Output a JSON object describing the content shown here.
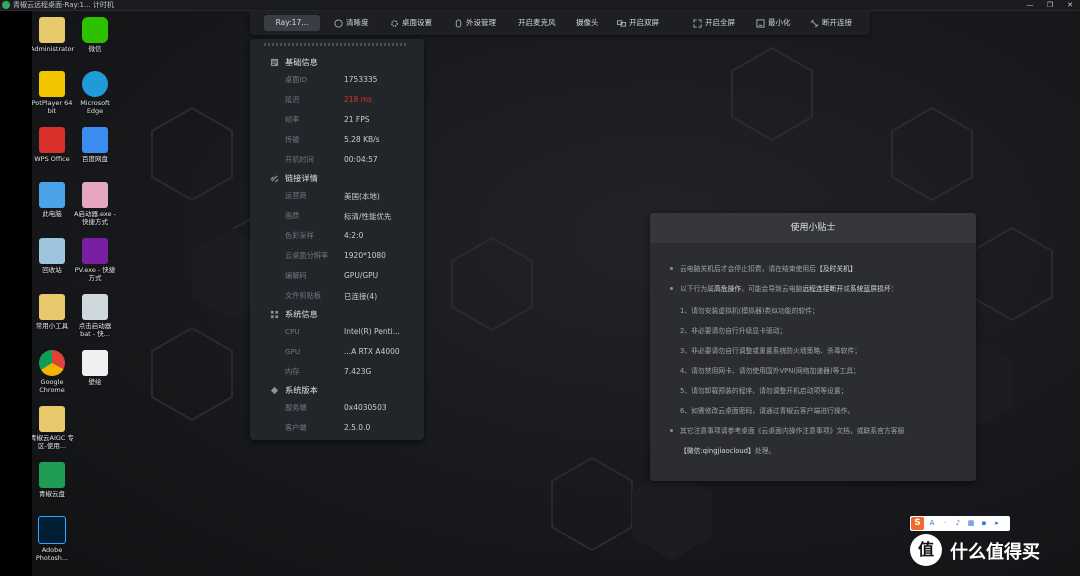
{
  "window": {
    "title": "青椒云远程桌面-Ray:1... 计时机",
    "minimize_glyph": "—",
    "restore_glyph": "❐",
    "close_glyph": "✕"
  },
  "desktop_icons": [
    {
      "name": "administrator-icon",
      "label": "Administrator",
      "icon": "folder-user-icon",
      "color": "#e7c86a"
    },
    {
      "name": "wechat-icon",
      "label": "微信",
      "icon": "wechat-icon",
      "color": "#2dc100"
    },
    {
      "name": "potplayer-icon",
      "label": "PotPlayer 64 bit",
      "icon": "potplayer-icon",
      "color": "#f2c400"
    },
    {
      "name": "edge-icon",
      "label": "Microsoft Edge",
      "icon": "edge-icon",
      "color": "#1f9cd8"
    },
    {
      "name": "wps-icon",
      "label": "WPS Office",
      "icon": "wps-icon",
      "color": "#d9302b"
    },
    {
      "name": "baidu-netdisk-icon",
      "label": "百度网盘",
      "icon": "baidu-netdisk-icon",
      "color": "#3b8df0"
    },
    {
      "name": "this-pc-icon",
      "label": "此电脑",
      "icon": "computer-icon",
      "color": "#4aa3e8"
    },
    {
      "name": "a-launcher-icon",
      "label": "A启动器.exe - 快捷方式",
      "icon": "anime-avatar-icon",
      "color": "#e7a6c0"
    },
    {
      "name": "recycle-bin-icon",
      "label": "回收站",
      "icon": "recycle-bin-icon",
      "color": "#9ec4de"
    },
    {
      "name": "pv-shortcut-icon",
      "label": "PV.exe - 快捷方式",
      "icon": "pv-icon",
      "color": "#7b1fa2"
    },
    {
      "name": "tools-icon",
      "label": "常用小工具",
      "icon": "folder-tools-icon",
      "color": "#e7c86a"
    },
    {
      "name": "launcher-bat-icon",
      "label": "点击启动器 bat - 快...",
      "icon": "bat-file-icon",
      "color": "#cfd8dc"
    },
    {
      "name": "chrome-icon",
      "label": "Google Chrome",
      "icon": "chrome-icon",
      "color": "#db4437"
    },
    {
      "name": "sketch-icon",
      "label": "壁绘",
      "icon": "sketch-icon",
      "color": "#f0f0f0"
    },
    {
      "name": "aigc-icon",
      "label": "青椒云AIGC 专区-使用...",
      "icon": "doc-icon",
      "color": "#e7c86a"
    },
    {
      "name": "qingjiao-disk-icon",
      "label": "青椒云盘",
      "icon": "qingjiao-icon",
      "color": "#1f9d55"
    },
    {
      "name": "photoshop-icon",
      "label": "Adobe Photosh...",
      "icon": "photoshop-icon",
      "color": "#31a8ff"
    }
  ],
  "toolbar": {
    "user_label": "Ray:17...",
    "items": [
      {
        "name": "clarity-button",
        "label": "清晰度",
        "icon": "clarity-icon"
      },
      {
        "name": "desktop-settings-button",
        "label": "桌面设置",
        "icon": "gear-icon"
      },
      {
        "name": "peripheral-button",
        "label": "外设管理",
        "icon": "mouse-icon"
      },
      {
        "name": "mic-button",
        "label": "开启麦克风",
        "icon": ""
      },
      {
        "name": "camera-button",
        "label": "摄像头",
        "icon": ""
      },
      {
        "name": "dual-screen-button",
        "label": "开启双屏",
        "icon": "dual-screen-icon"
      },
      {
        "name": "fullscreen-button",
        "label": "开启全屏",
        "icon": "fullscreen-icon"
      },
      {
        "name": "minimize-button",
        "label": "最小化",
        "icon": "minimize-icon"
      },
      {
        "name": "disconnect-button",
        "label": "断开连接",
        "icon": "disconnect-icon"
      }
    ]
  },
  "info_panel": {
    "sections": [
      {
        "name": "basic-info",
        "title": "基础信息",
        "icon": "list-icon",
        "rows": [
          {
            "label": "桌面ID",
            "value": "1753335",
            "status": ""
          },
          {
            "label": "延迟",
            "value": "218 ms",
            "status": "bad"
          },
          {
            "label": "帧率",
            "value": "21 FPS",
            "status": ""
          },
          {
            "label": "传输",
            "value": "5.28 KB/s",
            "status": ""
          },
          {
            "label": "开机时间",
            "value": "00:04:57",
            "status": ""
          }
        ]
      },
      {
        "name": "link-details",
        "title": "链接详情",
        "icon": "link-icon",
        "rows": [
          {
            "label": "运营商",
            "value": "美国(本地)",
            "status": ""
          },
          {
            "label": "画质",
            "value": "标清/性能优先",
            "status": ""
          },
          {
            "label": "色彩采样",
            "value": "4:2:0",
            "status": ""
          },
          {
            "label": "云桌面分辨率",
            "value": "1920*1080",
            "status": ""
          },
          {
            "label": "编解码",
            "value": "GPU/GPU",
            "status": ""
          },
          {
            "label": "文件剪贴板",
            "value": "已连接(4)",
            "status": ""
          }
        ]
      },
      {
        "name": "system-info",
        "title": "系统信息",
        "icon": "grid-icon",
        "rows": [
          {
            "label": "CPU",
            "value": "Intel(R) Penti...",
            "status": ""
          },
          {
            "label": "GPU",
            "value": "...A RTX A4000",
            "status": ""
          },
          {
            "label": "内存",
            "value": "7.423G",
            "status": ""
          }
        ]
      },
      {
        "name": "system-version",
        "title": "系统版本",
        "icon": "version-icon",
        "rows": [
          {
            "label": "服务端",
            "value": "0x4030503",
            "status": ""
          },
          {
            "label": "客户端",
            "value": "2.5.0.0",
            "status": ""
          }
        ]
      }
    ]
  },
  "tips": {
    "title": "使用小贴士",
    "line1": "云电脑关机后才会停止扣费，请在结束使用后",
    "line1_em": "【及时关机】",
    "line2_a": "以下行为属",
    "line2_em1": "高危操作",
    "line2_b": "，可能会导致云电脑",
    "line2_em2": "远程连接断开",
    "line2_c": "或",
    "line2_em3": "系统蓝屏损坏",
    "line2_d": "：",
    "items": [
      "1、请勿安装虚拟机(模拟器)类似功能的软件；",
      "2、非必要请勿自行升级显卡驱动；",
      "3、非必要请勿自行调整或重置系统防火墙策略、杀毒软件；",
      "4、请勿禁用网卡、请勿使用国外VPN(网络加速器)等工具；",
      "5、请勿卸载预装的程序、请勿调整开机启动项等设置；",
      "6、如需修改云桌面密码，请通过青椒云客户端进行操作。"
    ],
    "line3": "其它注意事项请参考桌面《云桌面内操作注意事项》文档，或联系官方客服",
    "line4_em": "【微信:qingjiaocloud】",
    "line4": "处理。"
  },
  "ime": {
    "logo": "S",
    "items": [
      "A",
      "·",
      "♪",
      "▦",
      "▪",
      "▸"
    ]
  },
  "watermark": {
    "circle": "值",
    "text": "什么值得买"
  },
  "colors": {
    "bad_status": "#e2332b",
    "panel_bg": "#22252a",
    "toolbar_bg": "#1d1f23",
    "brand_green": "#2fae5a"
  }
}
